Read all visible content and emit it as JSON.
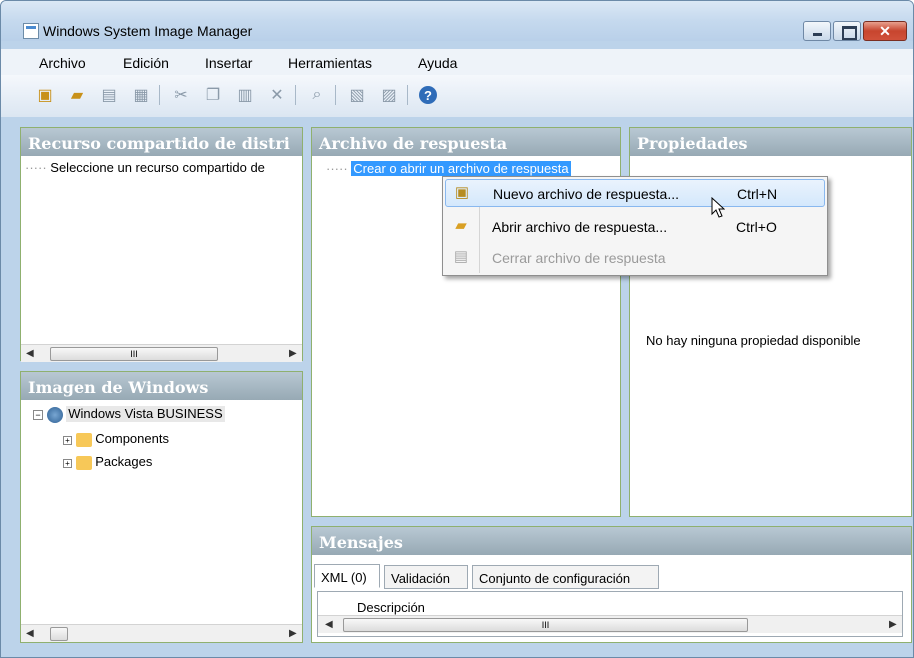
{
  "window": {
    "title": "Windows System Image Manager",
    "close": "✕"
  },
  "menu": [
    "Archivo",
    "Edición",
    "Insertar",
    "Herramientas",
    "Ayuda"
  ],
  "toolbar": {
    "icons": [
      "new-answer-file-icon",
      "open-folder-icon",
      "close-file-icon",
      "save-icon",
      "cut-icon",
      "copy-icon",
      "paste-icon",
      "delete-icon",
      "search-icon",
      "validate-icon",
      "config-icon",
      "help-icon"
    ],
    "help_glyph": "?"
  },
  "distribution": {
    "header": "Recurso compartido de distri",
    "item": "Seleccione un recurso compartido de"
  },
  "image": {
    "header": "Imagen de Windows",
    "root": "Windows Vista BUSINESS",
    "children": [
      "Components",
      "Packages"
    ]
  },
  "answer": {
    "header": "Archivo de respuesta",
    "item": "Crear o abrir un archivo de respuesta"
  },
  "properties": {
    "header": "Propiedades",
    "empty": "No hay ninguna propiedad disponible"
  },
  "messages": {
    "header": "Mensajes",
    "tabs": [
      "XML (0)",
      "Validación",
      "Conjunto de configuración"
    ],
    "column": "Descripción"
  },
  "context_menu": [
    {
      "label": "Nuevo archivo de respuesta...",
      "shortcut": "Ctrl+N",
      "enabled": true,
      "icon": "new-file-icon"
    },
    {
      "label": "Abrir archivo de respuesta...",
      "shortcut": "Ctrl+O",
      "enabled": true,
      "icon": "open-folder-icon"
    },
    {
      "label": "Cerrar archivo de respuesta",
      "shortcut": "",
      "enabled": false,
      "icon": "close-file-icon"
    }
  ],
  "scroll": {
    "thumb": "III",
    "left": "◀",
    "right": "▶"
  }
}
